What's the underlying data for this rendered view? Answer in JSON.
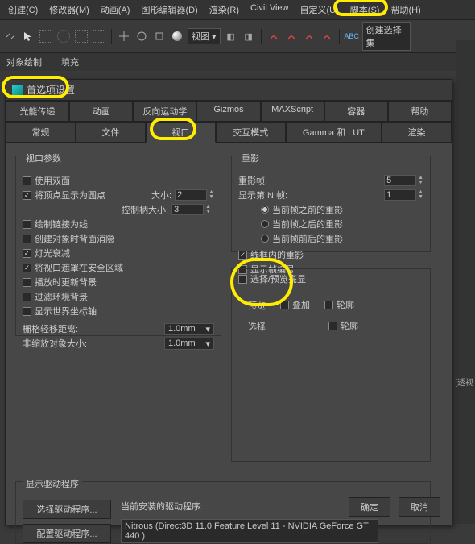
{
  "menu": {
    "items": [
      "创建(C)",
      "修改器(M)",
      "动画(A)",
      "图形编辑器(D)",
      "渲染(R)",
      "Civil View",
      "自定义(U)",
      "脚本(S)",
      "帮助(H)"
    ]
  },
  "toolbar": {
    "viewmode": "视图",
    "create_input": "创建选择集"
  },
  "subbar": {
    "left": "对象绘制",
    "right": "填充"
  },
  "dialog": {
    "title": "首选项设置",
    "tabs1": [
      "光能传递",
      "动画",
      "反向运动学",
      "Gizmos",
      "MAXScript",
      "容器",
      "帮助"
    ],
    "tabs2": [
      "常规",
      "文件",
      "视口",
      "交互模式",
      "Gamma 和 LUT",
      "渲染"
    ],
    "viewport": {
      "title": "视口参数",
      "use_dual": "使用双面",
      "show_vertex": "将顶点显示为圆点",
      "size_label": "大小:",
      "size_val": "2",
      "handle_label": "控制柄大小:",
      "handle_val": "3",
      "draw_links": "绘制链接为线",
      "backface": "创建对象时背面消隐",
      "light_atten": "灯光衰减",
      "mask_safe": "将视口遮罩在安全区域",
      "update_bg": "播放时更新背景",
      "filter_env": "过滤环境背景",
      "show_world": "显示世界坐标轴",
      "grid_dist": "栅格轻移距离:",
      "grid_val": "1.0mm",
      "nonscale": "非缩放对象大小:",
      "nonscale_val": "1.0mm"
    },
    "ghost": {
      "title": "重影",
      "frames_label": "重影帧:",
      "frames_val": "5",
      "nth_label": "显示第 N 帧:",
      "nth_val": "1",
      "before": "当前帧之前的重影",
      "after": "当前帧之后的重影",
      "around": "当前帧前后的重影",
      "wireframe": "线框内的重影",
      "show_num": "显示帧编号"
    },
    "select": {
      "title": "选择/预览亮显",
      "preview": "预览",
      "overlay": "叠加",
      "outline": "轮廓",
      "sel": "选择",
      "outline2": "轮廓"
    },
    "driver": {
      "title": "显示驱动程序",
      "choose": "选择驱动程序...",
      "config": "配置驱动程序...",
      "installed_label": "当前安装的驱动程序:",
      "installed": "Nitrous (Direct3D 11.0 Feature Level 11 - NVIDIA GeForce GT 440 )"
    },
    "ok": "确定",
    "cancel": "取消"
  },
  "side_label": "[透视"
}
